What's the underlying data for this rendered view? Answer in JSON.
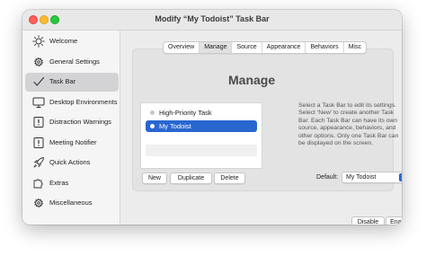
{
  "window": {
    "title": "Modify “My Todoist” Task Bar"
  },
  "sidebar": {
    "items": [
      {
        "label": "Welcome",
        "icon": "sun-icon"
      },
      {
        "label": "General Settings",
        "icon": "gear-icon"
      },
      {
        "label": "Task Bar",
        "icon": "checkmark-icon",
        "selected": true
      },
      {
        "label": "Desktop Environments",
        "icon": "monitor-icon"
      },
      {
        "label": "Distraction Warnings",
        "icon": "warning-icon"
      },
      {
        "label": "Meeting Notifier",
        "icon": "bell-icon"
      },
      {
        "label": "Quick Actions",
        "icon": "rocket-icon"
      },
      {
        "label": "Extras",
        "icon": "puzzle-icon"
      },
      {
        "label": "Miscellaneous",
        "icon": "gear-icon"
      }
    ]
  },
  "tabs": [
    "Overview",
    "Manage",
    "Source",
    "Appearance",
    "Behaviors",
    "Misc"
  ],
  "active_tab": "Manage",
  "manage": {
    "heading": "Manage",
    "task_bars": [
      {
        "label": "High-Priority Task",
        "selected": false
      },
      {
        "label": "My Todoist",
        "selected": true
      }
    ],
    "description": "Select a Task Bar to edit its settings. Select ‘New’ to create another Task Bar. Each Task Bar can have its own source, appearance, behaviors, and other options. Only one Task Bar can be displayed on the screen.",
    "buttons": {
      "new": "New",
      "duplicate": "Duplicate",
      "delete": "Delete"
    },
    "default_label": "Default:",
    "default_value": "My Todoist"
  },
  "footer": {
    "disable": "Disable",
    "enable": "Enable"
  },
  "colors": {
    "accent": "#2866d0",
    "selected_sidebar": "#d3d3d5"
  }
}
